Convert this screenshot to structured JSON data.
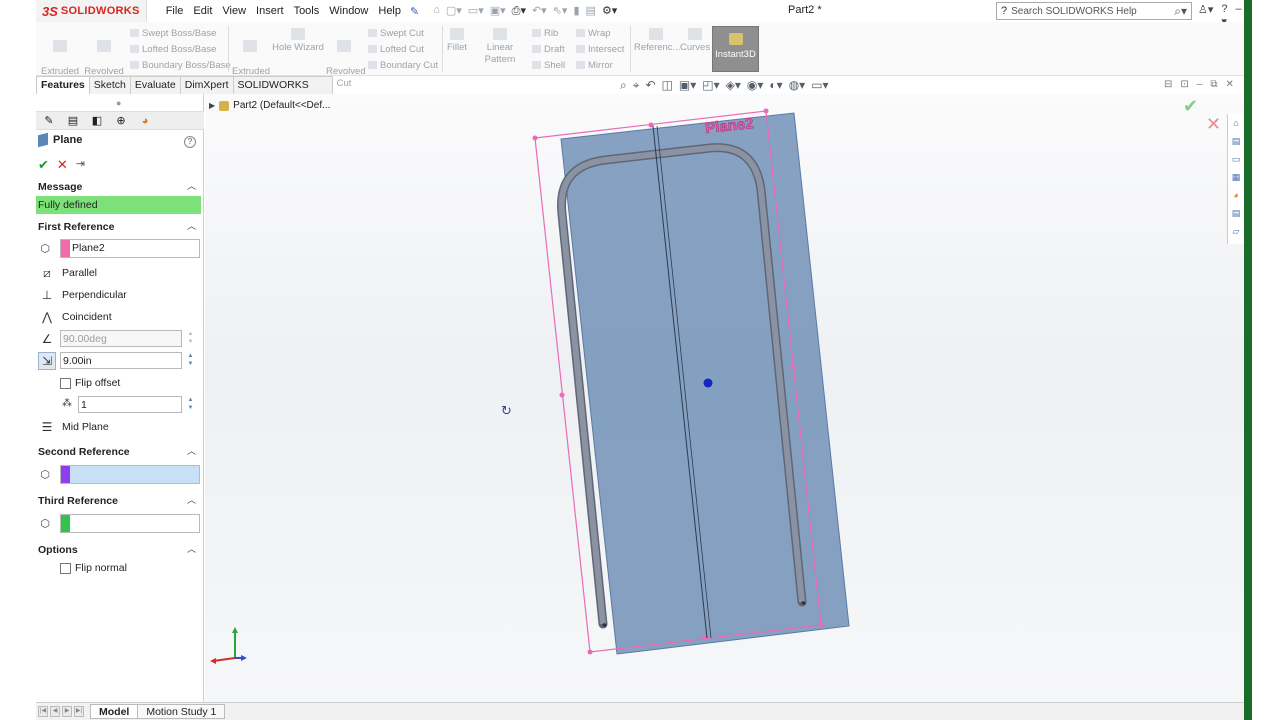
{
  "titlebar": {
    "logo_ds": "3S",
    "logo_text": "SOLIDWORKS",
    "menu": [
      "File",
      "Edit",
      "View",
      "Insert",
      "Tools",
      "Window",
      "Help"
    ],
    "document_title": "Part2 *",
    "search_placeholder": "Search SOLIDWORKS Help"
  },
  "command_manager": {
    "extruded_boss": "Extruded\nBoss/Base",
    "revolved_boss": "Revolved\nBoss/Base",
    "swept_boss": "Swept Boss/Base",
    "lofted_boss": "Lofted Boss/Base",
    "boundary_boss": "Boundary Boss/Base",
    "extruded_cut": "Extruded\nCut",
    "hole_wizard": "Hole Wizard",
    "revolved_cut": "Revolved\nCut",
    "swept_cut": "Swept Cut",
    "lofted_cut": "Lofted Cut",
    "boundary_cut": "Boundary Cut",
    "fillet": "Fillet",
    "linear_pattern": "Linear Pattern",
    "rib": "Rib",
    "draft": "Draft",
    "shell": "Shell",
    "wrap": "Wrap",
    "intersect": "Intersect",
    "mirror": "Mirror",
    "reference": "Referenc...",
    "curves": "Curves",
    "instant3d": "Instant3D"
  },
  "tabs": [
    "Features",
    "Sketch",
    "Evaluate",
    "DimXpert",
    "SOLIDWORKS Add-Ins"
  ],
  "tree": {
    "root_label": "Part2  (Default<<Def..."
  },
  "property_manager": {
    "title": "Plane",
    "message_heading": "Message",
    "message_text": "Fully defined",
    "first_reference": {
      "heading": "First Reference",
      "value": "Plane2",
      "swatch_color": "#f06ba8",
      "parallel": "Parallel",
      "perpendicular": "Perpendicular",
      "coincident": "Coincident",
      "angle_value": "90.00deg",
      "offset_value": "9.00in",
      "flip_offset": "Flip offset",
      "instances_value": "1",
      "mid_plane": "Mid Plane"
    },
    "second_reference": {
      "heading": "Second Reference",
      "value": "",
      "swatch_color": "#8f3df0"
    },
    "third_reference": {
      "heading": "Third Reference",
      "value": "",
      "swatch_color": "#33c24a"
    },
    "options": {
      "heading": "Options",
      "flip_normal": "Flip normal"
    }
  },
  "viewport": {
    "plane_label": "Plane2",
    "plane_fill": "#6d8eb5",
    "preview_color": "#ea6bb8"
  },
  "bottom_tabs": [
    "Model",
    "Motion Study 1"
  ],
  "colors": {
    "accent_green": "#7de17a",
    "brand_red": "#d7261e",
    "ok_green": "#1e9a2f",
    "cancel_red": "#d32020"
  }
}
